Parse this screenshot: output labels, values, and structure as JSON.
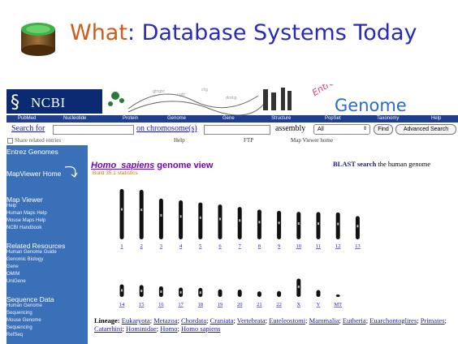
{
  "slide": {
    "title_prefix": "What",
    "title_rest": ": Database Systems Today",
    "icon": "database-icon"
  },
  "ncbi": {
    "logo_text": "NCBI",
    "entrez_word": "Entrez",
    "genome_word": "Genome"
  },
  "navbar": {
    "items": [
      "PubMed",
      "Nucleotide",
      "Protein",
      "Genome",
      "Gene",
      "Structure",
      "PopSet",
      "Taxonomy",
      "Help"
    ]
  },
  "search": {
    "search_for_label": "Search for",
    "search_value": "",
    "on_chromosome_label": "on chromosome(s)",
    "chromosome_value": "",
    "assembly_label": "assembly",
    "assembly_selected": "All",
    "find_label": "Find",
    "advanced_label": "Advanced Search"
  },
  "subnav": {
    "share_label": "Share related entries",
    "help": "Help",
    "ftp": "FTP",
    "map_viewer_home": "Map Viewer home"
  },
  "sidebar": {
    "entrez_genomes": "Entrez Genomes",
    "mapviewer_home": "MapViewer Home",
    "sections": [
      {
        "heading": "Map Viewer",
        "items": [
          "Help",
          "Human Maps Help",
          "Mouse Maps Help",
          "NCBI Handbook"
        ]
      },
      {
        "heading": "Related Resources",
        "items": [
          "Human Genome Guide",
          "Genomic Biology",
          "Gene",
          "OMIM",
          "UniGene"
        ]
      },
      {
        "heading": "Sequence Data",
        "items": [
          "Human Genome",
          "Sequencing",
          "Mouse Genome",
          "Sequencing",
          "RefSeq"
        ]
      }
    ]
  },
  "main": {
    "species": "Homo_sapiens",
    "view_title": " genome view",
    "build_stats": "Build 35.1 statistics",
    "blast_bold": "BLAST search",
    "blast_rest": " the human genome"
  },
  "chromosomes": {
    "row1": [
      "1",
      "2",
      "3",
      "4",
      "5",
      "6",
      "7",
      "8",
      "9",
      "10",
      "11",
      "12",
      "13"
    ],
    "row2": [
      "14",
      "15",
      "16",
      "17",
      "18",
      "19",
      "20",
      "21",
      "22",
      "X",
      "Y",
      "MT"
    ],
    "row1_lengths": [
      247,
      243,
      200,
      191,
      181,
      171,
      159,
      146,
      140,
      135,
      134,
      132,
      114
    ],
    "row2_lengths": [
      106,
      100,
      89,
      79,
      76,
      64,
      62,
      47,
      50,
      155,
      58,
      0.016
    ]
  },
  "lineage": {
    "label": "Lineage:",
    "taxa": [
      "Eukaryota",
      "Metazoa",
      "Chordata",
      "Craniata",
      "Vertebrata",
      "Euteleostomi",
      "Mammalia",
      "Eutheria",
      "Euarchontoglires",
      "Primates",
      "Catarrhini",
      "Hominidae",
      "Homo",
      "Homo sapiens"
    ]
  },
  "colors": {
    "ncbi_blue": "#0a2a72",
    "navbar": "#1f3e8c",
    "sidebar": "#3a70b8",
    "title_orange": "#d55a1a",
    "title_blue": "#2a2ab8",
    "species_purple": "#7a00c0"
  }
}
